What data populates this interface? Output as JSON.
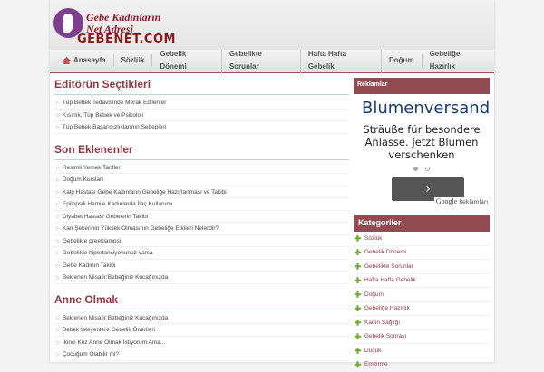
{
  "logo": {
    "line1": "Gebe Kadınların",
    "line2": "Net Adresi",
    "line3": "GEBENET.COM"
  },
  "nav": [
    "Anasayfa",
    "Sözlük",
    "Gebelik Dönemi",
    "Gebelikte Sorunlar",
    "Hafta Hafta Gebelik",
    "Doğum",
    "Gebeliğe Hazırlık"
  ],
  "sections": [
    {
      "title": "Editörün Seçtikleri",
      "items": [
        "Tüp Bebek Tedavisinde Merak Edilenler",
        "Kısırlık, Tüp Bebek ve Psikoloji",
        "Tüp Bebek Başarısızlıklarının Sebepleri"
      ]
    },
    {
      "title": "Son Eklenenler",
      "items": [
        "Resimli Yemek Tarifleri",
        "Doğum Kursları",
        "Kalp Hastası Gebe Kadınların Gebeliğe Hazırlanması ve Takibi",
        "Epilepsili Hamile Kadınlarda İlaç Kullanımı",
        "Diyabet Hastası Gebelerin Takibi",
        "Kan Şekerinin Yüksek Olmasının Gebeliğe Etkileri Nelerdir?",
        "Gebelikte preeklampsi",
        "Gebelikte hipertansiyonunuz varsa",
        "Gebe Kadının Takibi",
        "Beklenen Misafir:Bebeğiniz Kucağınızda"
      ]
    },
    {
      "title": "Anne Olmak",
      "items": [
        "Beklenen Misafir:Bebeğiniz Kucağınızda",
        "Bebek İsteyenlere Gebelik Önerileri",
        "İkinci Kez Anne Olmak İstiyorum Ama...",
        "Çocuğum Olabilir mi?"
      ]
    }
  ],
  "ads": {
    "header": "Reklamlar",
    "title": "Blumenversand",
    "desc": "Sträuße für besondere Anlässe. Jetzt Blumen verschenken",
    "button": "›",
    "google": "Google",
    "google_label": "Reklamları"
  },
  "categories": {
    "header": "Kategoriler",
    "items": [
      "Sözlük",
      "Gebelik Dönemi",
      "Gebelikte Sorunlar",
      "Hafta Hafta Gebelik",
      "Doğum",
      "Gebeliğe Hazırlık",
      "Kadın Sağlığı",
      "Gebelik Sonrası",
      "Düşük",
      "Emzirme"
    ]
  }
}
